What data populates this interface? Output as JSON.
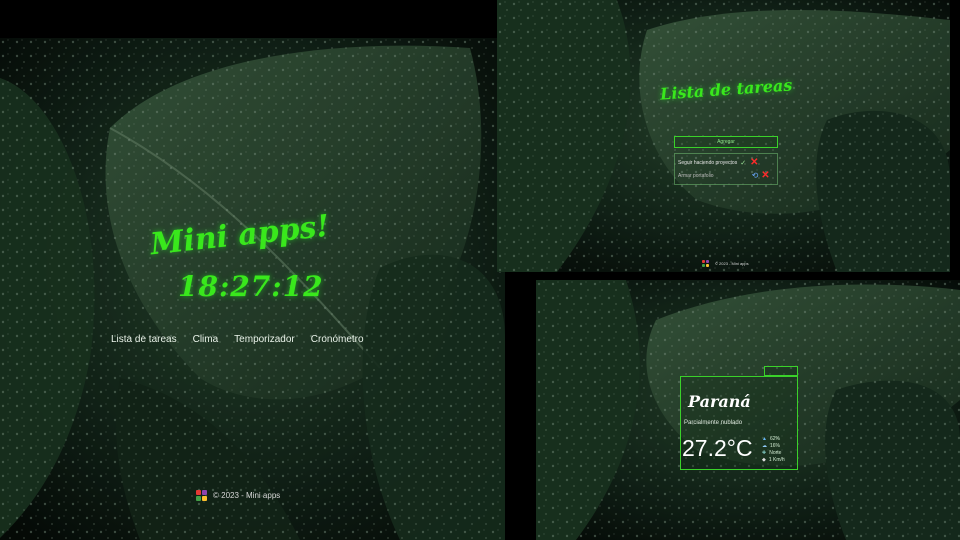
{
  "main": {
    "title": "Mini apps!",
    "clock": "18:27:12",
    "nav": [
      "Lista de tareas",
      "Clima",
      "Temporizador",
      "Cronómetro"
    ],
    "footer": "© 2023 - Mini apps"
  },
  "todo": {
    "title": "Lista de tareas",
    "add_label": "Agregar",
    "items": [
      {
        "text": "Seguir haciendo proyectos"
      },
      {
        "text": "Armar portafolio"
      }
    ],
    "footer": "© 2023 - Mini apps"
  },
  "weather": {
    "city": "Paraná",
    "description": "Parcialmente nublado",
    "temperature": "27.2°C",
    "details": [
      "62%",
      "16%",
      "Norte",
      "1 Km/h"
    ]
  },
  "colors": {
    "accent": "#39e81c",
    "delete": "#ff2b2b",
    "logo": [
      "#e53935",
      "#8e44ad",
      "#43a047",
      "#fbc02d"
    ]
  }
}
